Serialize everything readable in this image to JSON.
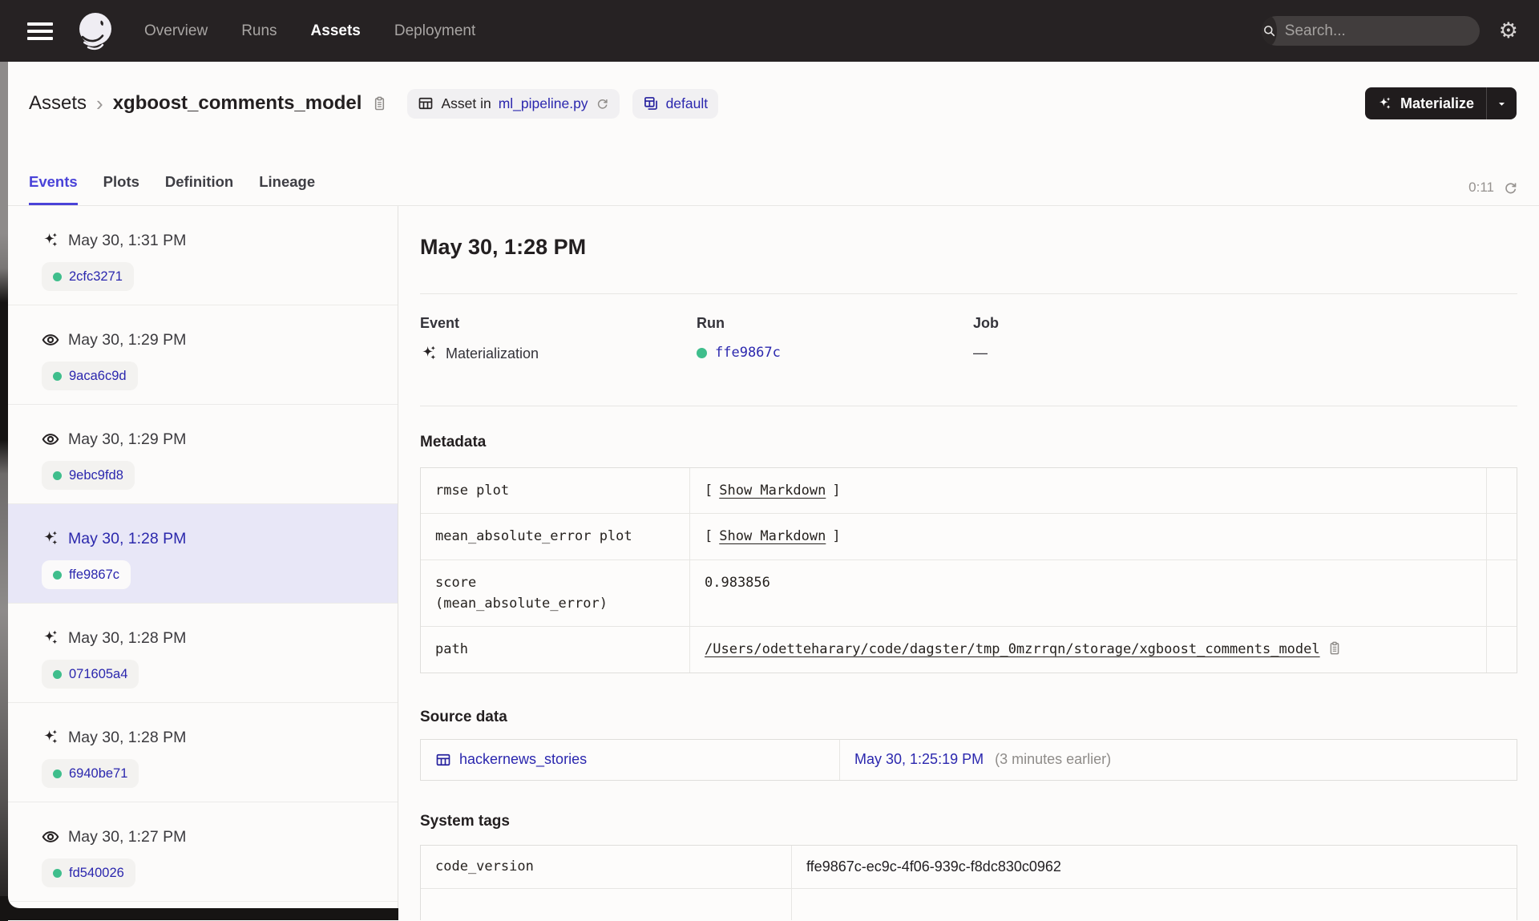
{
  "nav": {
    "items": [
      {
        "label": "Overview",
        "active": false
      },
      {
        "label": "Runs",
        "active": false
      },
      {
        "label": "Assets",
        "active": true
      },
      {
        "label": "Deployment",
        "active": false
      }
    ],
    "search": {
      "placeholder": "Search...",
      "shortcut": "/"
    }
  },
  "icons": {
    "settings_glyph": "⚙"
  },
  "breadcrumb": {
    "root": "Assets",
    "separator": "›",
    "asset": "xgboost_comments_model"
  },
  "chips": {
    "asset_in": {
      "prefix": "Asset in",
      "file": "ml_pipeline.py"
    },
    "group": "default"
  },
  "materialize_button": {
    "label": "Materialize"
  },
  "tabs": {
    "items": [
      {
        "label": "Events"
      },
      {
        "label": "Plots"
      },
      {
        "label": "Definition"
      },
      {
        "label": "Lineage"
      }
    ],
    "active": "Events",
    "refresh_timer": "0:11"
  },
  "sidebar": {
    "events": [
      {
        "time": "May 30, 1:31 PM",
        "run_id": "2cfc3271",
        "type": "materialization",
        "selected": false
      },
      {
        "time": "May 30, 1:29 PM",
        "run_id": "9aca6c9d",
        "type": "observation",
        "selected": false
      },
      {
        "time": "May 30, 1:29 PM",
        "run_id": "9ebc9fd8",
        "type": "observation",
        "selected": false
      },
      {
        "time": "May 30, 1:28 PM",
        "run_id": "ffe9867c",
        "type": "materialization",
        "selected": true
      },
      {
        "time": "May 30, 1:28 PM",
        "run_id": "071605a4",
        "type": "materialization",
        "selected": false
      },
      {
        "time": "May 30, 1:28 PM",
        "run_id": "6940be71",
        "type": "materialization",
        "selected": false
      },
      {
        "time": "May 30, 1:27 PM",
        "run_id": "fd540026",
        "type": "observation",
        "selected": false
      }
    ]
  },
  "detail": {
    "title": "May 30, 1:28 PM",
    "summary": {
      "event_label": "Event",
      "event_value": "Materialization",
      "run_label": "Run",
      "run_value": "ffe9867c",
      "job_label": "Job",
      "job_value": "—"
    },
    "metadata": {
      "heading": "Metadata",
      "bracket_open": "[",
      "bracket_close": "]",
      "rows": [
        {
          "key": "rmse plot",
          "link": "Show Markdown"
        },
        {
          "key": "mean_absolute_error plot",
          "link": "Show Markdown"
        },
        {
          "key": "score\n(mean_absolute_error)",
          "value": "0.983856"
        },
        {
          "key": "path",
          "path": "/Users/odetteharary/code/dagster/tmp_0mzrrqn/storage/xgboost_comments_model"
        }
      ]
    },
    "source_data": {
      "heading": "Source data",
      "asset": "hackernews_stories",
      "time": "May 30, 1:25:19 PM",
      "relative": "(3 minutes earlier)"
    },
    "system_tags": {
      "heading": "System tags",
      "rows": [
        {
          "key": "code_version",
          "value": "ffe9867c-ec9c-4f06-939c-f8dc830c0962"
        }
      ]
    }
  },
  "colors": {
    "accent_indigo": "#4A43D8",
    "link_navy": "#2B27AE",
    "run_status_green": "#3FBE8C",
    "topnav_bg": "#262223"
  }
}
